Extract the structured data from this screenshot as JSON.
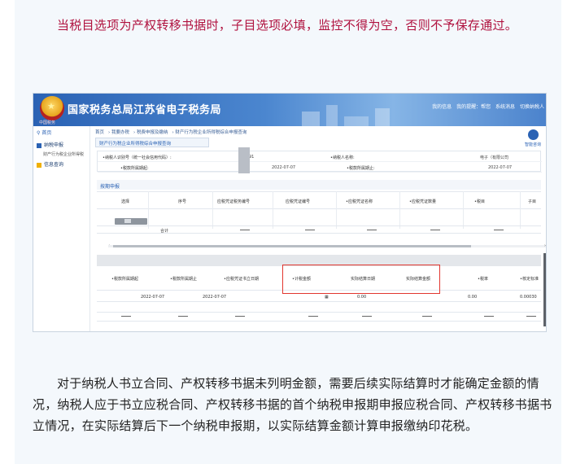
{
  "article": {
    "intro": "当税目选项为产权转移书据时，子目选项必填，监控不得为空，否则不予保存通过。",
    "body": "对于纳税人书立合同、产权转移书据未列明金额，需要后续实际结算时才能确定金额的情况，纳税人应于书立应税合同、产权转移书据的首个纳税申报期申报应税合同、产权转移书据书立情况，在实际结算后下一个纳税申报期，以实际结算金额计算申报缴纳印花税。"
  },
  "app": {
    "title": "国家税务总局江苏省电子税务局",
    "emblem_text": "中国税务",
    "links": [
      "我的信息",
      "我的提醒：帮您",
      "系统消息",
      "切换纳税人"
    ]
  },
  "sidebar": {
    "home": "首页",
    "items": [
      {
        "label": "纳税申报",
        "color": "#2a62b4"
      },
      {
        "label": "信息查询",
        "color": "#f0b000"
      }
    ],
    "sub_item": "财产行为税企业所得税"
  },
  "breadcrumb": [
    "首页",
    "我要办税",
    "税费申报及缴纳",
    "财产行为税企业所得税综合申报查询"
  ],
  "tab": "财产行为税企业所得税综合申报查询",
  "smart_label": "智能咨询",
  "form": {
    "row1": {
      "label_left": "•纳税人识别号（统一社会信用代码）:",
      "value_left": "91",
      "label_right": "•纳税人名称:",
      "value_right": "电子（有限公司"
    },
    "row2": {
      "label_left": "•税款所属期起:",
      "value_left": "2022-07-07",
      "label_right": "•税款所属期止:",
      "value_right": "2022-07-07"
    }
  },
  "section_title": "按期申报",
  "table1": {
    "headers": [
      "选择",
      "序号",
      "应税凭证税务编号",
      "应税凭证编号",
      "•应税凭证名称",
      "•应税凭证数量",
      "•税目",
      "子目"
    ],
    "sum_label": "合计"
  },
  "table2": {
    "headers": [
      "•税款所属期起",
      "•税款所属期止",
      "•应税凭证书立日期",
      "•计税金额",
      "实际结算日期",
      "实际结算金额",
      "•税率",
      "•核定标准"
    ],
    "row": {
      "period_start": "2022-07-07",
      "period_end": "2022-07-07",
      "tax_amount": "0.00",
      "settle_amount": "0.00",
      "rate": "0.00030"
    }
  }
}
